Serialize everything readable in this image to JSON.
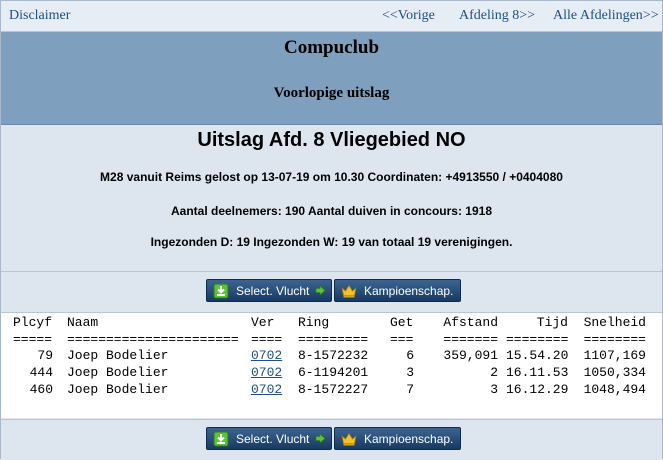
{
  "nav": {
    "disclaimer": "Disclaimer",
    "prev": "<<Vorige",
    "next": "Afdeling 8>>",
    "all": "Alle Afdelingen>>"
  },
  "banner": {
    "club": "Compuclub",
    "subtitle": "Voorlopige uitslag"
  },
  "info": {
    "title": "Uitslag Afd. 8 Vliegebied NO",
    "line1": "M28 vanuit Reims gelost op 13-07-19 om 10.30 Coordinaten: +4913550 / +0404080",
    "line2": "Aantal deelnemers: 190 Aantal duiven in concours: 1918",
    "line3": "Ingezonden D: 19 Ingezonden W: 19 van totaal 19 verenigingen."
  },
  "buttons": {
    "select_label": "Select. Vlucht",
    "kamp_label": "Kampioenschap.",
    "select_icon": "download-icon",
    "kamp_icon": "crown-icon"
  },
  "colors": {
    "banner": "#7f9fbe",
    "panel": "#dde6ef",
    "link": "#1f4f85",
    "button": "#173a63",
    "icon_green": "#5cc23a",
    "icon_gold": "#f2c12e"
  },
  "table": {
    "headers": {
      "plc": "Plcyf",
      "naam": "Naam",
      "ver": "Ver",
      "ring": "Ring",
      "get": "Get",
      "afst": "Afstand",
      "tijd": "Tijd",
      "snel": "Snelheid"
    },
    "separators": {
      "plc": "=====",
      "naam": "======================",
      "ver": "====",
      "ring": "=========",
      "get": "===",
      "afst": "=======",
      "tijd": "========",
      "snel": "========"
    },
    "rows": [
      {
        "plc": "79",
        "naam": "Joep Bodelier",
        "ver": "0702",
        "ring": "8-1572232",
        "get": "6",
        "afst": "359,091",
        "tijd": "15.54.20",
        "snel": "1107,169"
      },
      {
        "plc": "444",
        "naam": "Joep Bodelier",
        "ver": "0702",
        "ring": "6-1194201",
        "get": "3",
        "afst": "2",
        "tijd": "16.11.53",
        "snel": "1050,334"
      },
      {
        "plc": "460",
        "naam": "Joep Bodelier",
        "ver": "0702",
        "ring": "8-1572227",
        "get": "7",
        "afst": "3",
        "tijd": "16.12.29",
        "snel": "1048,494"
      }
    ]
  }
}
